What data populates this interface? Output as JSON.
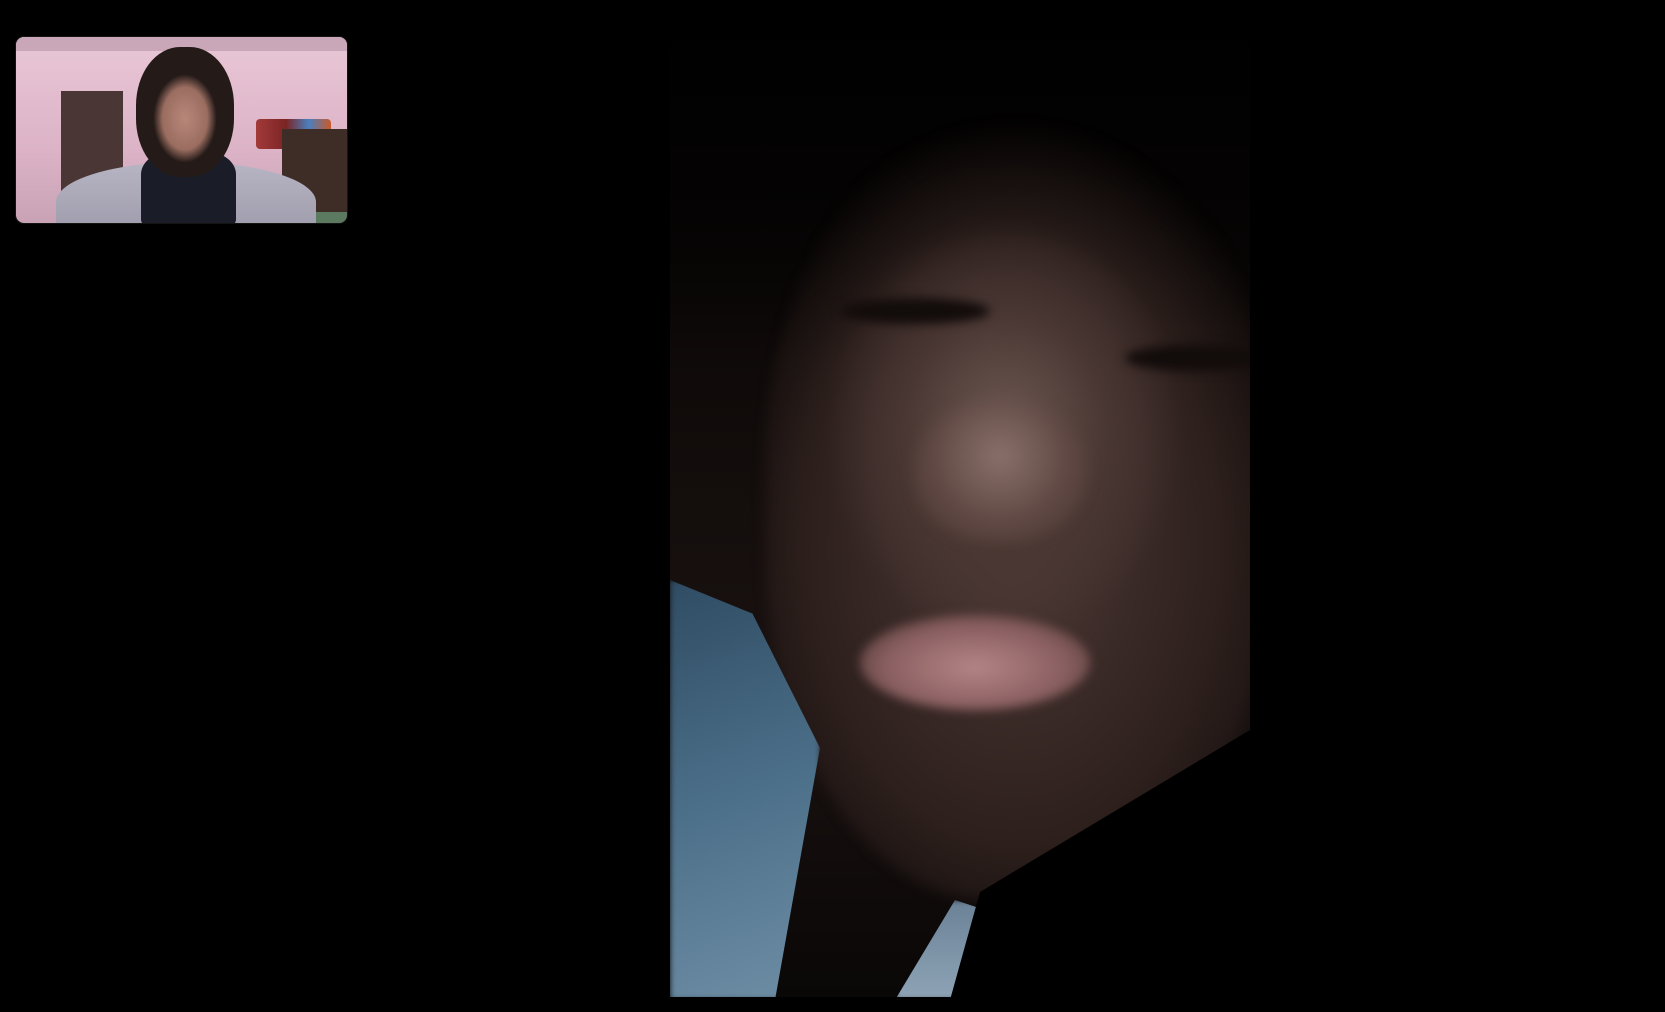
{
  "call": {
    "remote_feed_label": "",
    "self_feed_label": ""
  },
  "controls": {
    "effects_icon": "smiley-sparkle-icon"
  },
  "colors": {
    "background": "#000000",
    "self_view_wall": "#e9c7d6"
  }
}
